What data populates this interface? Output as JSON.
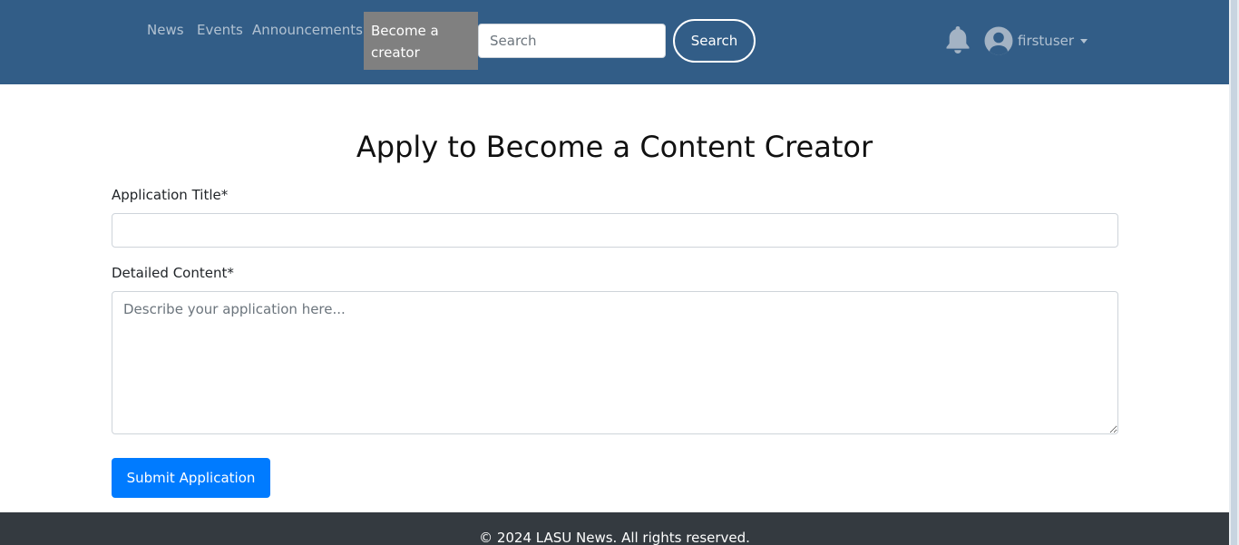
{
  "nav": {
    "links": [
      "News",
      "Events",
      "Announcements"
    ],
    "active": "Become a creator",
    "search_placeholder": "Search",
    "search_button": "Search",
    "username": "firstuser"
  },
  "colors": {
    "navbar": "#325d87",
    "active_nav": "#808080",
    "primary_button": "#007bff",
    "footer": "#343a40"
  },
  "icons": {
    "notifications": "bell-icon",
    "user": "user-circle-icon",
    "dropdown": "caret-down-icon"
  },
  "form": {
    "heading": "Apply to Become a Content Creator",
    "title_label": "Application Title*",
    "title_value": "",
    "content_label": "Detailed Content*",
    "content_placeholder": "Describe your application here...",
    "submit_label": "Submit Application"
  },
  "footer": {
    "text": "© 2024 LASU News. All rights reserved."
  }
}
